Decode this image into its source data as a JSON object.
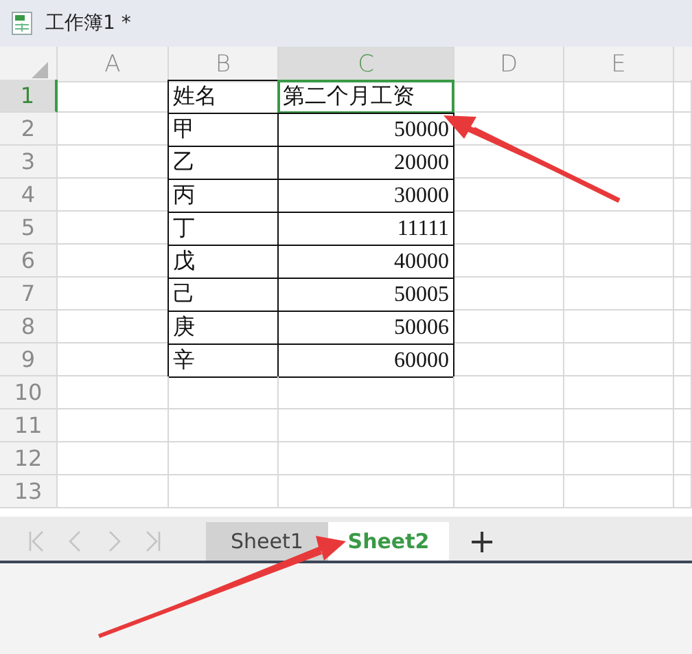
{
  "window": {
    "title": "工作簿1 *"
  },
  "columns": [
    {
      "label": "A",
      "selected": false
    },
    {
      "label": "B",
      "selected": false
    },
    {
      "label": "C",
      "selected": true
    },
    {
      "label": "D",
      "selected": false
    },
    {
      "label": "E",
      "selected": false
    }
  ],
  "rows": [
    {
      "label": "1",
      "selected": true,
      "kind": "header",
      "name": "姓名",
      "amount": "第二个月工资"
    },
    {
      "label": "2",
      "selected": false,
      "kind": "data",
      "name": "甲",
      "amount": "50000"
    },
    {
      "label": "3",
      "selected": false,
      "kind": "data",
      "name": "乙",
      "amount": "20000"
    },
    {
      "label": "4",
      "selected": false,
      "kind": "data",
      "name": "丙",
      "amount": "30000"
    },
    {
      "label": "5",
      "selected": false,
      "kind": "data",
      "name": "丁",
      "amount": "11111"
    },
    {
      "label": "6",
      "selected": false,
      "kind": "data",
      "name": "戊",
      "amount": "40000"
    },
    {
      "label": "7",
      "selected": false,
      "kind": "data",
      "name": "己",
      "amount": "50005"
    },
    {
      "label": "8",
      "selected": false,
      "kind": "data",
      "name": "庚",
      "amount": "50006"
    },
    {
      "label": "9",
      "selected": false,
      "kind": "data",
      "name": "辛",
      "amount": "60000"
    },
    {
      "label": "10",
      "selected": false,
      "kind": "empty"
    },
    {
      "label": "11",
      "selected": false,
      "kind": "empty"
    },
    {
      "label": "12",
      "selected": false,
      "kind": "empty"
    },
    {
      "label": "13",
      "selected": false,
      "kind": "empty"
    }
  ],
  "sheet_nav": {
    "disabled": true
  },
  "tabs": [
    {
      "label": "Sheet1",
      "selected": false
    },
    {
      "label": "Sheet2",
      "selected": true
    }
  ],
  "add_sheet": "+"
}
